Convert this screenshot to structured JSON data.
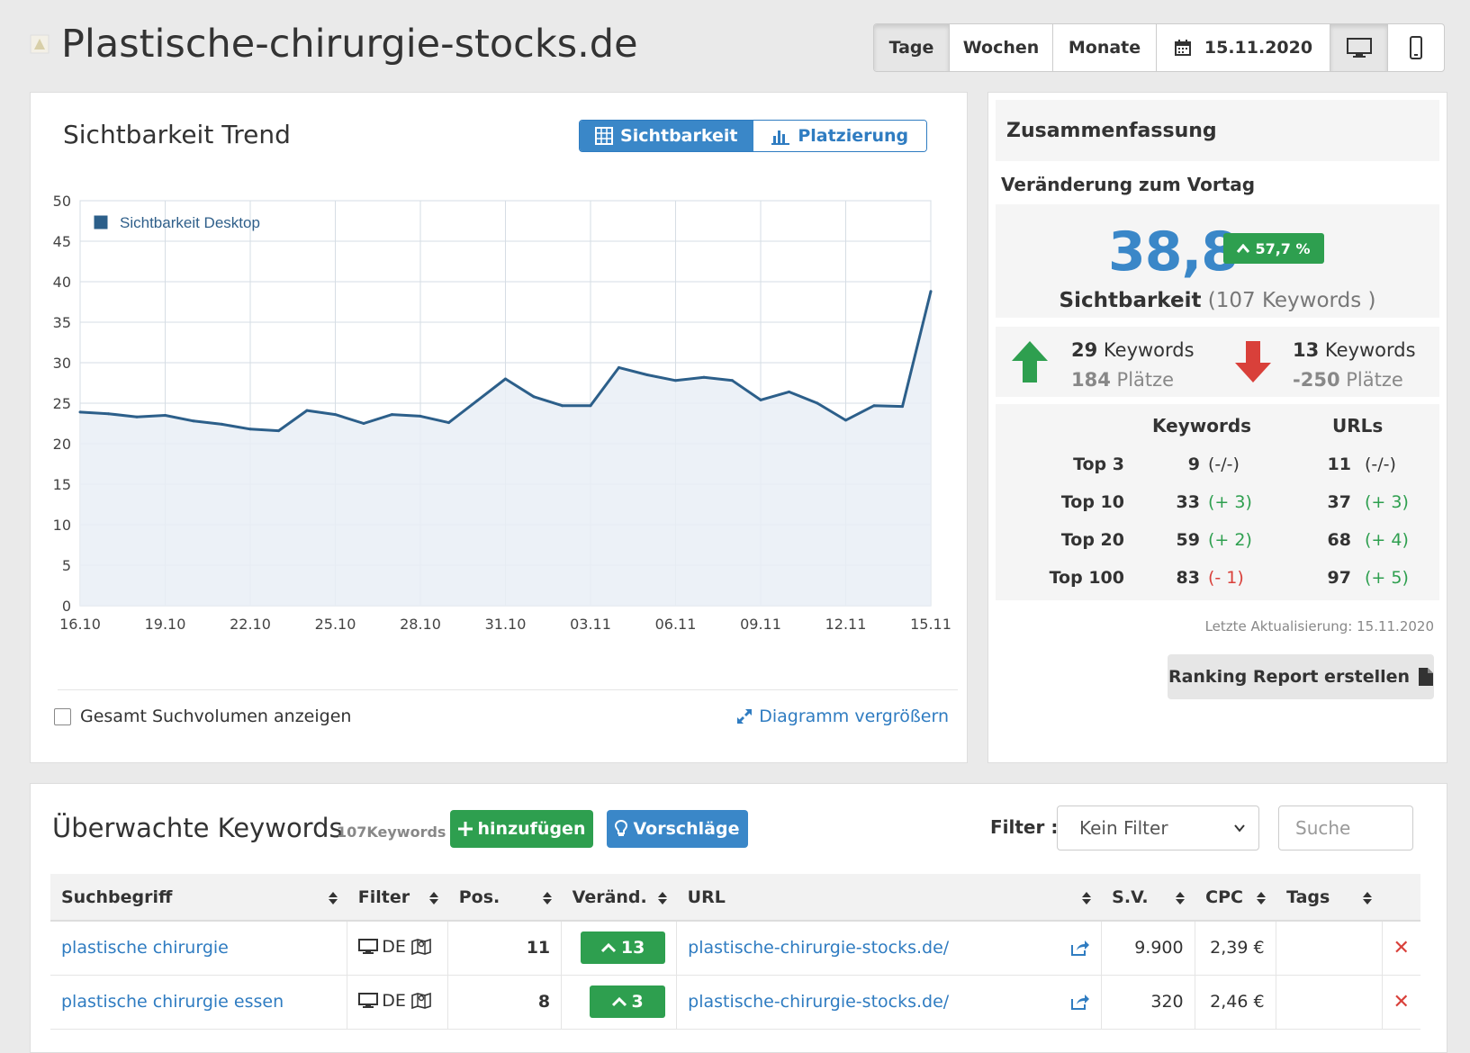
{
  "page": {
    "title": "Plastische-chirurgie-stocks.de"
  },
  "top_controls": {
    "days": "Tage",
    "weeks": "Wochen",
    "months": "Monate",
    "date": "15.11.2020",
    "icons": [
      "calendar-icon",
      "desktop-icon",
      "mobile-icon"
    ]
  },
  "trend": {
    "title": "Sichtbarkeit Trend",
    "toggle_visibility": "Sichtbarkeit",
    "toggle_ranking": "Platzierung",
    "show_volume": "Gesamt Suchvolumen anzeigen",
    "enlarge": "Diagramm vergrößern"
  },
  "chart_data": {
    "type": "area",
    "legend": "Sichtbarkeit Desktop",
    "legend_position": "top-left",
    "grid": true,
    "x": [
      "16.10",
      "17.10",
      "18.10",
      "19.10",
      "20.10",
      "21.10",
      "22.10",
      "23.10",
      "24.10",
      "25.10",
      "26.10",
      "27.10",
      "28.10",
      "29.10",
      "30.10",
      "31.10",
      "01.11",
      "02.11",
      "03.11",
      "04.11",
      "05.11",
      "06.11",
      "07.11",
      "08.11",
      "09.11",
      "10.11",
      "11.11",
      "12.11",
      "13.11",
      "14.11",
      "15.11"
    ],
    "x_ticks": [
      "16.10",
      "19.10",
      "22.10",
      "25.10",
      "28.10",
      "31.10",
      "03.11",
      "06.11",
      "09.11",
      "12.11",
      "15.11"
    ],
    "values": [
      23.9,
      23.7,
      23.3,
      23.5,
      22.8,
      22.4,
      21.8,
      21.6,
      24.1,
      23.6,
      22.5,
      23.6,
      23.4,
      22.6,
      25.3,
      28.0,
      25.8,
      24.7,
      24.7,
      29.4,
      28.5,
      27.8,
      28.2,
      27.8,
      25.4,
      26.4,
      25.0,
      22.9,
      24.7,
      24.6,
      38.8
    ],
    "ylim": [
      0,
      50
    ],
    "y_ticks": [
      0,
      5,
      10,
      15,
      20,
      25,
      30,
      35,
      40,
      45,
      50
    ],
    "color": "#2c5f8a"
  },
  "summary": {
    "header": "Zusammenfassung",
    "subheader": "Veränderung zum Vortag",
    "value": "38,8",
    "change": "57,7 %",
    "label_bold": "Sichtbarkeit",
    "label_rest": "(107 Keywords )",
    "up": {
      "count": "29",
      "label": "Keywords",
      "places": "184",
      "places_label": "Plätze"
    },
    "down": {
      "count": "13",
      "label": "Keywords",
      "places": "-250",
      "places_label": "Plätze"
    },
    "col_keywords": "Keywords",
    "col_urls": "URLs",
    "rows": [
      {
        "label": "Top 3",
        "kw": "9",
        "kw_change": "(-/-)",
        "kw_tone": "neutral",
        "url": "11",
        "url_change": "(-/-)",
        "url_tone": "neutral"
      },
      {
        "label": "Top 10",
        "kw": "33",
        "kw_change": "(+ 3)",
        "kw_tone": "green",
        "url": "37",
        "url_change": "(+ 3)",
        "url_tone": "green"
      },
      {
        "label": "Top 20",
        "kw": "59",
        "kw_change": "(+ 2)",
        "kw_tone": "green",
        "url": "68",
        "url_change": "(+ 4)",
        "url_tone": "green"
      },
      {
        "label": "Top 100",
        "kw": "83",
        "kw_change": "(- 1)",
        "kw_tone": "red",
        "url": "97",
        "url_change": "(+ 5)",
        "url_tone": "green"
      }
    ],
    "last_update": "Letzte Aktualisierung: 15.11.2020",
    "report_button": "Ranking Report erstellen"
  },
  "keywords": {
    "title": "Überwachte Keywords",
    "count": "107Keywords",
    "add_button": "hinzufügen",
    "suggest_button": "Vorschläge",
    "filter_label": "Filter :",
    "filter_value": "Kein Filter",
    "search_placeholder": "Suche",
    "columns": {
      "term": "Suchbegriff",
      "filter": "Filter",
      "pos": "Pos.",
      "change": "Veränd.",
      "url": "URL",
      "sv": "S.V.",
      "cpc": "CPC",
      "tags": "Tags"
    },
    "rows": [
      {
        "term": "plastische chirurgie",
        "country": "DE",
        "pos": "11",
        "change": "13",
        "url": "plastische-chirurgie-stocks.de/",
        "sv": "9.900",
        "cpc": "2,39 €"
      },
      {
        "term": "plastische chirurgie essen",
        "country": "DE",
        "pos": "8",
        "change": "3",
        "url": "plastische-chirurgie-stocks.de/",
        "sv": "320",
        "cpc": "2,46 €"
      }
    ]
  },
  "colors": {
    "accent": "#3a87c8",
    "success": "#2e9f4f",
    "danger": "#d9403a",
    "line": "#2c5f8a"
  }
}
